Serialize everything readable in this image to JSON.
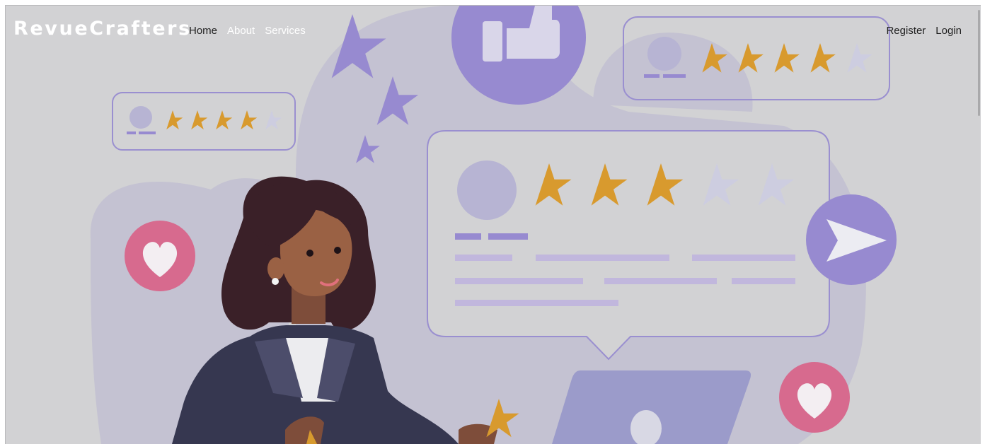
{
  "brand": {
    "name": "RevueCrafters"
  },
  "nav": {
    "home": "Home",
    "about": "About",
    "services": "Services",
    "register": "Register",
    "login": "Login"
  },
  "hero": {
    "ratings": {
      "small_card": 4,
      "top_card": 4,
      "main_card": 3,
      "max": 5
    }
  },
  "colors": {
    "page_bg": "#d2d2d4",
    "blob": "#c4c2d2",
    "card_border": "#9a8fd0",
    "star_gold": "#d89a2e",
    "star_empty": "#cdcde0",
    "purple": "#978ad0",
    "pink": "#d76a8e",
    "lilac_line": "#c1b7dd"
  },
  "icons": {
    "thumbs_up": "thumbs-up-icon",
    "send": "send-icon",
    "heart": "heart-icon",
    "star": "star-icon",
    "avatar": "avatar-icon"
  }
}
